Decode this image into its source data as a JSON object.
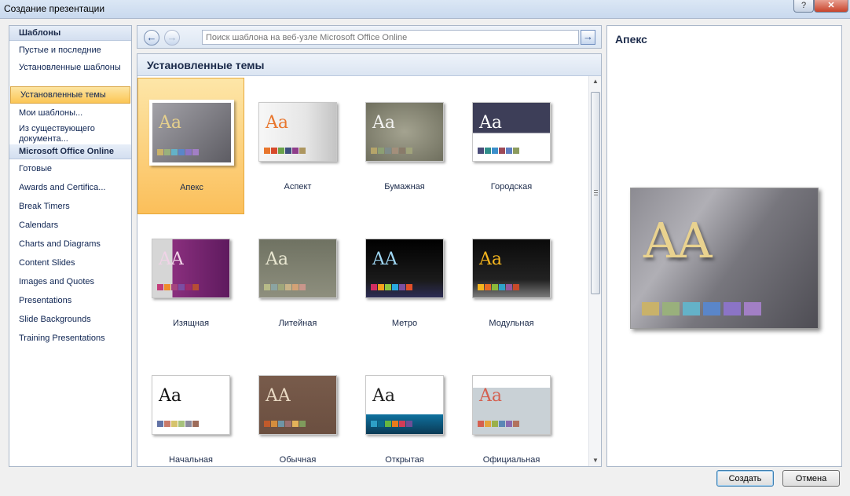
{
  "window": {
    "title": "Создание презентации",
    "help": "?",
    "close": "✕"
  },
  "sidebar": {
    "section1": "Шаблоны",
    "items1": [
      "Пустые и последние",
      "Установленные шаблоны",
      "Установленные темы",
      "Мои шаблоны...",
      "Из существующего документа..."
    ],
    "selected_index": 2,
    "section2": "Microsoft Office Online",
    "items2": [
      "Готовые",
      "Awards and Certifica...",
      "Break Timers",
      "Calendars",
      "Charts and Diagrams",
      "Content Slides",
      "Images and Quotes",
      "Presentations",
      "Slide Backgrounds",
      "Training Presentations"
    ]
  },
  "search": {
    "placeholder": "Поиск шаблона на веб-узле Microsoft Office Online",
    "back_icon": "back-arrow-icon",
    "forward_icon": "forward-arrow-icon",
    "go_icon": "go-arrow-icon"
  },
  "gallery": {
    "heading": "Установленные темы",
    "themes": [
      {
        "name": "Апекс",
        "glyph": "Aa",
        "selected": true
      },
      {
        "name": "Аспект",
        "glyph": "Aa"
      },
      {
        "name": "Бумажная",
        "glyph": "Aa"
      },
      {
        "name": "Городская",
        "glyph": "Aa"
      },
      {
        "name": "Изящная",
        "glyph": "AA"
      },
      {
        "name": "Литейная",
        "glyph": "Aa"
      },
      {
        "name": "Метро",
        "glyph": "AA"
      },
      {
        "name": "Модульная",
        "glyph": "Aa"
      },
      {
        "name": "Начальная",
        "glyph": "Aa"
      },
      {
        "name": "Обычная",
        "glyph": "AA"
      },
      {
        "name": "Открытая",
        "glyph": "Aa"
      },
      {
        "name": "Официальная",
        "glyph": "Aa"
      }
    ]
  },
  "preview": {
    "title": "Апекс",
    "glyph": "AA"
  },
  "buttons": {
    "create": "Создать",
    "cancel": "Отмена"
  }
}
